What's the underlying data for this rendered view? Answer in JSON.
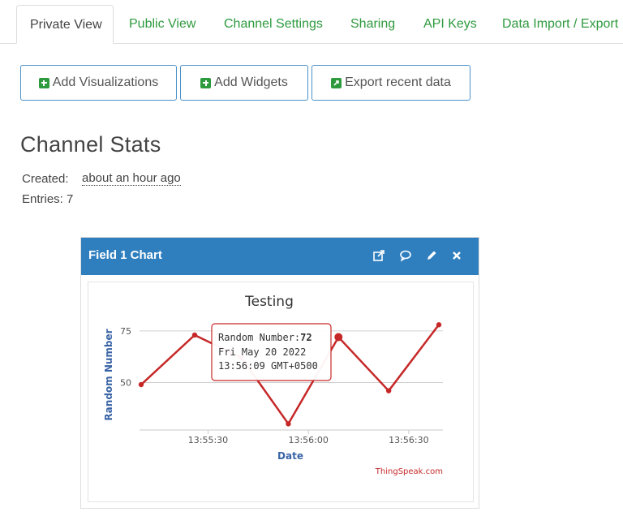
{
  "tabs": [
    {
      "label": "Private View",
      "active": true
    },
    {
      "label": "Public View"
    },
    {
      "label": "Channel Settings"
    },
    {
      "label": "Sharing"
    },
    {
      "label": "API Keys"
    },
    {
      "label": "Data Import / Export"
    }
  ],
  "buttons": {
    "add_visualizations": "Add Visualizations",
    "add_widgets": "Add Widgets",
    "export_recent": "Export recent data"
  },
  "channel_stats": {
    "title": "Channel Stats",
    "created_label": "Created:",
    "created_value": "about an hour ago",
    "entries": "Entries: 7"
  },
  "widget": {
    "title": "Field 1 Chart",
    "icons": [
      "external-link-icon",
      "comment-icon",
      "pencil-icon",
      "close-icon"
    ]
  },
  "colors": {
    "accent_green": "#2e9a3e",
    "header_blue": "#2f7fbf",
    "line_red": "#c62828"
  },
  "chart_data": {
    "type": "line",
    "title": "Testing",
    "xlabel": "Date",
    "ylabel": "Random Number",
    "x_ticks": [
      "13:55:30",
      "13:56:00",
      "13:56:30"
    ],
    "y_ticks": [
      50,
      75
    ],
    "series": [
      {
        "values": [
          {
            "x": "13:55:10",
            "y": 49
          },
          {
            "x": "13:55:26",
            "y": 73
          },
          {
            "x": "13:55:40",
            "y": 62
          },
          {
            "x": "13:55:54",
            "y": 30
          },
          {
            "x": "13:56:09",
            "y": 72
          },
          {
            "x": "13:56:24",
            "y": 46
          },
          {
            "x": "13:56:39",
            "y": 78
          }
        ]
      }
    ],
    "tooltip": {
      "label": "Random Number:",
      "value": "72",
      "date": "Fri May 20 2022",
      "time": "13:56:09 GMT+0500"
    },
    "credit": "ThingSpeak.com"
  }
}
